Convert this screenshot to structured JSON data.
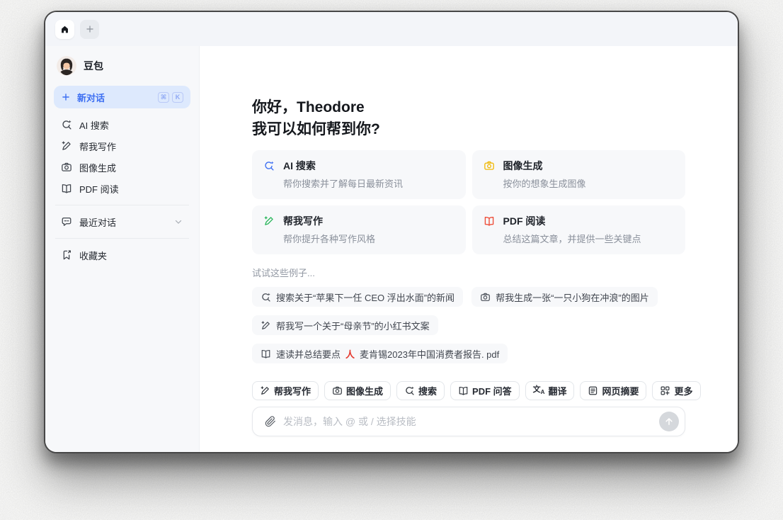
{
  "colors": {
    "accent_blue": "#3D6FF2",
    "new_chat_bg": "#DDE9FD",
    "search_blue": "#3D6FF2",
    "write_green": "#2FB85F",
    "image_yellow": "#F0B90B",
    "pdf_red": "#EE4D38",
    "pdf_file_red": "#E5372C"
  },
  "tab_bar": {
    "tabs": [
      {
        "name": "home",
        "icon": "home-icon"
      },
      {
        "name": "new-tab",
        "icon": "plus-icon"
      }
    ]
  },
  "sidebar": {
    "profile": {
      "name": "豆包",
      "avatar": "girl-avatar"
    },
    "new_chat": {
      "label": "新对话",
      "icon": "plus-icon",
      "shortcut": [
        "⌘",
        "K"
      ]
    },
    "items": [
      {
        "icon": "ai-search-icon",
        "label": "AI 搜索"
      },
      {
        "icon": "write-icon",
        "label": "帮我写作"
      },
      {
        "icon": "image-gen-icon",
        "label": "图像生成"
      },
      {
        "icon": "pdf-read-icon",
        "label": "PDF 阅读"
      },
      {
        "icon": "recent-chats-icon",
        "label": "最近对话",
        "chevron": "chevron-down-icon"
      },
      {
        "icon": "favorites-icon",
        "label": "收藏夹"
      }
    ]
  },
  "main": {
    "greeting": {
      "line1": "你好，Theodore",
      "line2": "我可以如何帮到你?"
    },
    "feature_cards": [
      {
        "icon": "ai-search-icon",
        "color": "#3D6FF2",
        "title": "AI 搜索",
        "desc": "帮你搜索并了解每日最新资讯"
      },
      {
        "icon": "image-gen-icon",
        "color": "#F0B90B",
        "title": "图像生成",
        "desc": "按你的想象生成图像"
      },
      {
        "icon": "write-icon",
        "color": "#2FB85F",
        "title": "帮我写作",
        "desc": "帮你提升各种写作风格"
      },
      {
        "icon": "pdf-read-icon",
        "color": "#EE4D38",
        "title": "PDF 阅读",
        "desc": "总结这篇文章，并提供一些关键点"
      }
    ],
    "examples_label": "试试这些例子...",
    "example_chips": [
      {
        "icon": "search-icon",
        "text": "搜索关于“苹果下一任 CEO 浮出水面”的新闻"
      },
      {
        "icon": "image-gen-icon",
        "text": "帮我生成一张“一只小狗在冲浪”的图片"
      },
      {
        "icon": "write-icon",
        "text": "帮我写一个关于“母亲节”的小红书文案"
      },
      {
        "icon": "pdf-read-icon",
        "text": "速读并总结要点",
        "attachment_icon": "pdf-file-icon",
        "attachment": "麦肯锡2023年中国消费者报告. pdf"
      }
    ]
  },
  "composer": {
    "skills": [
      {
        "icon": "write-icon",
        "label": "帮我写作"
      },
      {
        "icon": "image-gen-icon",
        "label": "图像生成"
      },
      {
        "icon": "search-icon",
        "label": "搜索"
      },
      {
        "icon": "pdf-read-icon",
        "label": "PDF 问答"
      },
      {
        "icon": "translate-icon",
        "label": "翻译"
      },
      {
        "icon": "webpage-summary-icon",
        "label": "网页摘要"
      },
      {
        "icon": "more-icon",
        "label": "更多"
      }
    ],
    "input": {
      "placeholder": "发消息，输入 @ 或 / 选择技能",
      "left_icon": "paperclip-icon",
      "send_icon": "arrow-up-icon"
    }
  }
}
